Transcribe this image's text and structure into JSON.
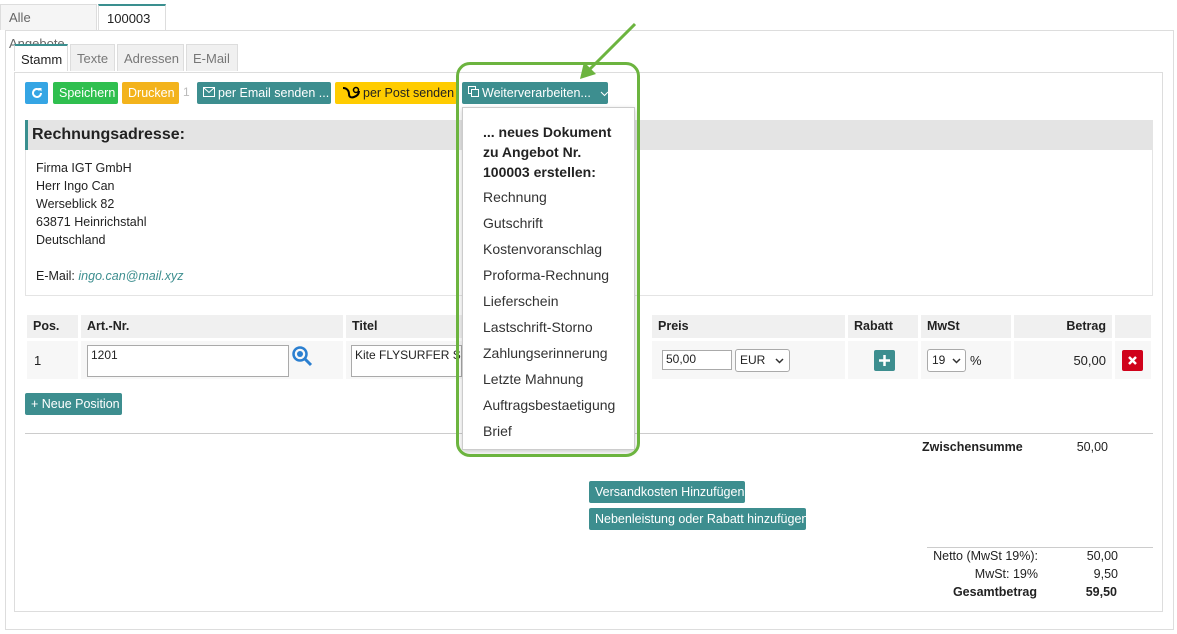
{
  "top_tabs": [
    "Alle Angebote",
    "100003"
  ],
  "sub_tabs": [
    "Stamm",
    "Texte",
    "Adressen",
    "E-Mail"
  ],
  "toolbar": {
    "save": "Speichern",
    "print": "Drucken",
    "hidden_char": "1",
    "email": "per Email senden ...",
    "post": "per Post senden",
    "further": "Weiterverarbeiten..."
  },
  "address": {
    "heading": "Rechnungsadresse:",
    "lines": [
      "Firma IGT GmbH",
      "Herr Ingo Can",
      "Werseblick 82",
      "63871 Heinrichstahl",
      "Deutschland"
    ],
    "email_label": "E-Mail:",
    "email": "ingo.can@mail.xyz"
  },
  "table": {
    "headers": {
      "pos": "Pos.",
      "art": "Art.-Nr.",
      "title": "Titel",
      "price": "Preis",
      "discount": "Rabatt",
      "tax": "MwSt",
      "amount": "Betrag"
    },
    "row": {
      "pos": "1",
      "art": "1201",
      "title": "Kite FLYSURFER S",
      "price": "50,00",
      "currency": "EUR",
      "tax": "19",
      "percent": "%",
      "amount": "50,00"
    }
  },
  "new_position": "+ Neue Position",
  "subtotal": {
    "label": "Zwischensumme",
    "value": "50,00"
  },
  "shipping_btn": "Versandkosten Hinzufügen",
  "extra_btn": "Nebenleistung oder Rabatt hinzufügen",
  "totals": {
    "net_label": "Netto (MwSt 19%):",
    "net": "50,00",
    "tax_label": "MwSt: 19%",
    "tax": "9,50",
    "gross_label": "Gesamtbetrag",
    "gross": "59,50"
  },
  "dropdown": {
    "heading_lines": [
      "... neues Dokument",
      "zu Angebot Nr.",
      "100003 erstellen:"
    ],
    "items": [
      "Rechnung",
      "Gutschrift",
      "Kostenvoranschlag",
      "Proforma-Rechnung",
      "Lieferschein",
      "Lastschrift-Storno",
      "Zahlungserinnerung",
      "Letzte Mahnung",
      "Auftragsbestaetigung",
      "Brief"
    ]
  },
  "colors": {
    "accent": "#3d8e8f",
    "save": "#2fbf4f",
    "print": "#f3b31c",
    "post": "#ffcc00",
    "highlight": "#6cb43f",
    "delete": "#d0021b"
  }
}
